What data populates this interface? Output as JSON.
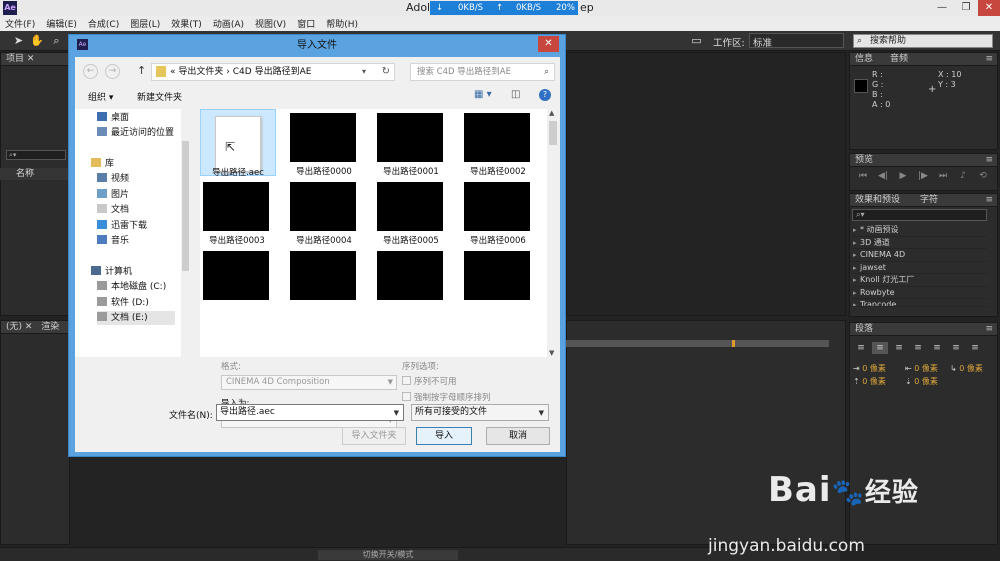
{
  "app": {
    "logo": "Ae",
    "title_left": "Adol",
    "title_right": "ep",
    "net_down": "0KB/S",
    "net_up": "0KB/S",
    "net_pct": "20%"
  },
  "menu": [
    "文件(F)",
    "编辑(E)",
    "合成(C)",
    "图层(L)",
    "效果(T)",
    "动画(A)",
    "视图(V)",
    "窗口",
    "帮助(H)"
  ],
  "toolbar": {
    "workspace_label": "工作区:",
    "workspace_value": "标准",
    "search_help": "搜索帮助"
  },
  "panels": {
    "project": "项目",
    "name_col": "名称",
    "none_tab": "(无)",
    "render_tab": "渲染",
    "info": "信息",
    "audio": "音频",
    "info_rgba": [
      "R :",
      "G :",
      "B :",
      "A : 0"
    ],
    "info_xy": [
      "X : 10",
      "Y : 3"
    ],
    "preview": "预览",
    "effects": "效果和预设",
    "character": "字符",
    "effects_items": [
      "* 动画预设",
      "3D 通道",
      "CINEMA 4D",
      "jawset",
      "Knoll 灯光工厂",
      "Rowbyte",
      "Trapcode"
    ],
    "paragraph": "段落",
    "indent_values": [
      "0 像素",
      "0 像素",
      "0 像素",
      "0 像素",
      "0 像素"
    ],
    "switch_mode": "切换开关/模式"
  },
  "dialog": {
    "title": "导入文件",
    "breadcrumb": [
      "«",
      "导出文件夹",
      "›",
      "C4D 导出路径到AE"
    ],
    "search_placeholder": "搜索 C4D 导出路径到AE",
    "organize": "组织 ▾",
    "new_folder": "新建文件夹",
    "nav_items": [
      {
        "label": "桌面",
        "icon": "desktop-icon"
      },
      {
        "label": "最近访问的位置",
        "icon": "recent-icon"
      },
      {
        "label": "库",
        "icon": "library-icon"
      },
      {
        "label": "视频",
        "icon": "video-icon"
      },
      {
        "label": "图片",
        "icon": "pictures-icon"
      },
      {
        "label": "文档",
        "icon": "documents-icon"
      },
      {
        "label": "迅雷下载",
        "icon": "download-icon"
      },
      {
        "label": "音乐",
        "icon": "music-icon"
      },
      {
        "label": "计算机",
        "icon": "computer-icon"
      },
      {
        "label": "本地磁盘 (C:)",
        "icon": "disk-icon"
      },
      {
        "label": "软件 (D:)",
        "icon": "disk-icon"
      },
      {
        "label": "文档 (E:)",
        "icon": "disk-icon"
      }
    ],
    "files": [
      "导出路径.aec",
      "导出路径0000",
      "导出路径0001",
      "导出路径0002",
      "导出路径0003",
      "导出路径0004",
      "导出路径0005",
      "导出路径0006"
    ],
    "format_label": "格式:",
    "format_value": "CINEMA 4D Composition",
    "import_as_label": "导入为:",
    "import_as_value": "",
    "sequence_label": "序列选项:",
    "seq_unavailable": "序列不可用",
    "force_alpha": "强制按字母顺序排列",
    "filename_label": "文件名(N):",
    "filename_value": "导出路径.aec",
    "filter_value": "所有可接受的文件",
    "btn_import_folder": "导入文件夹",
    "btn_import": "导入",
    "btn_cancel": "取消"
  },
  "watermark": {
    "brand": "Bai",
    "brand2": "经验",
    "url": "jingyan.baidu.com"
  }
}
